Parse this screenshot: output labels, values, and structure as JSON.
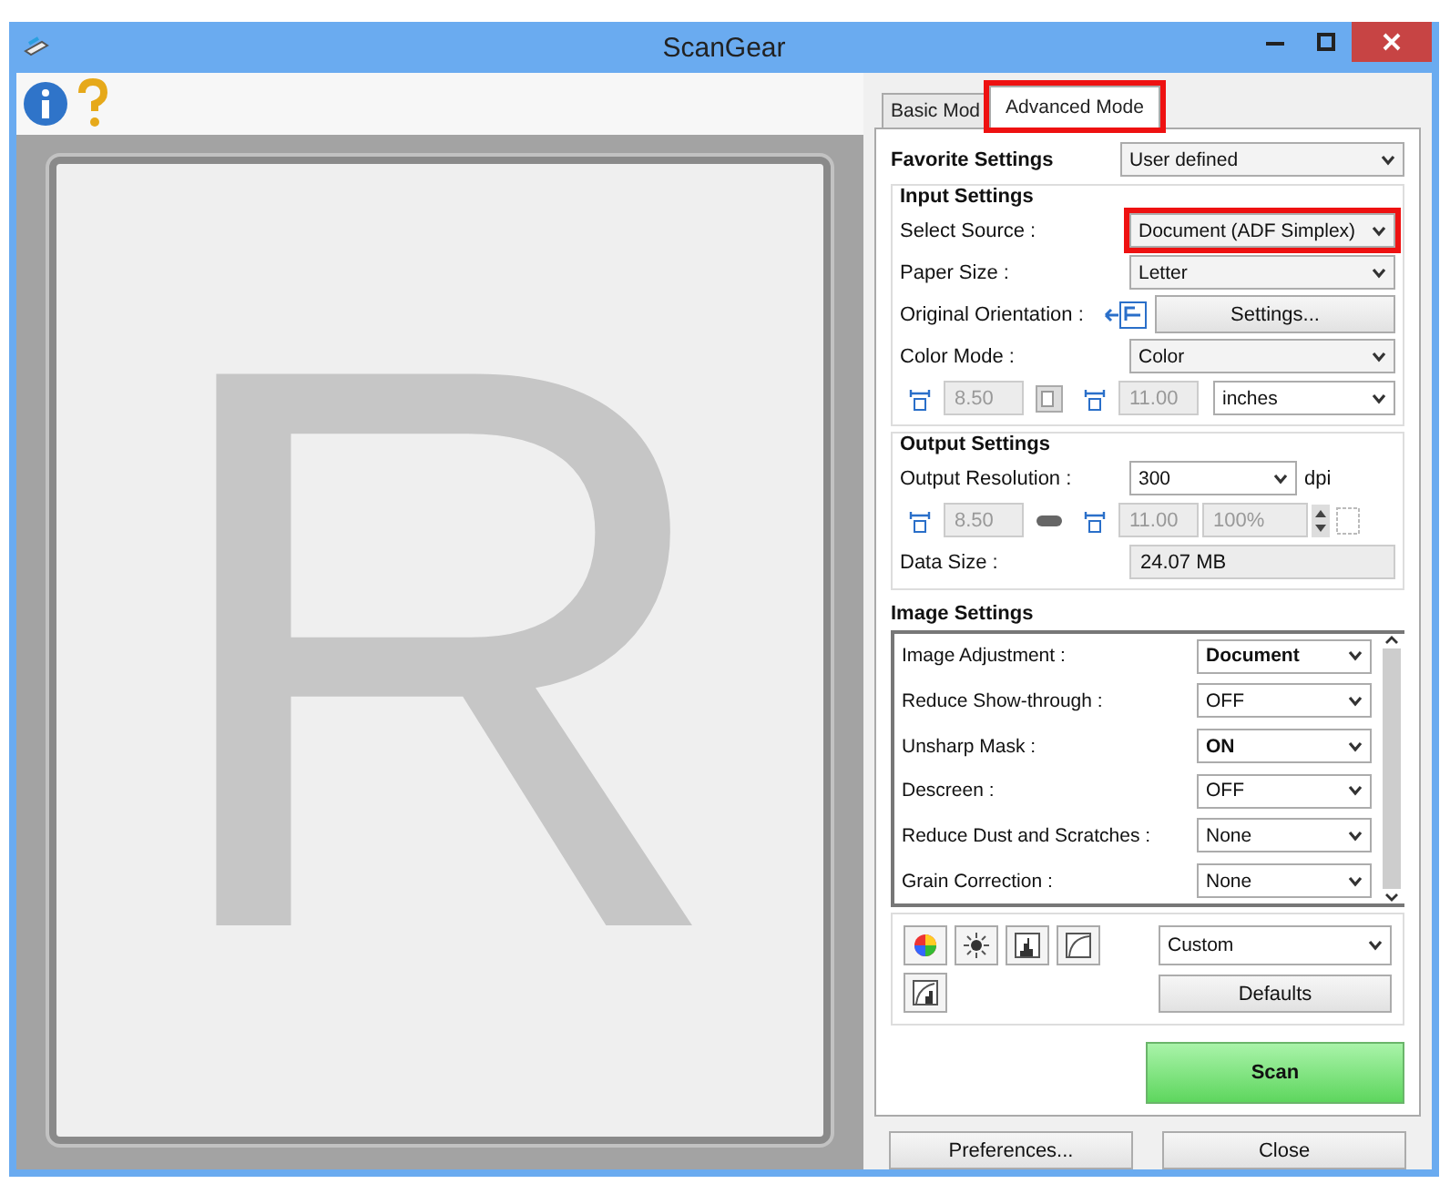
{
  "window": {
    "title": "ScanGear"
  },
  "preview": {
    "text": "R"
  },
  "tabs": [
    {
      "label": "Basic Mod",
      "selected": false,
      "highlighted": false
    },
    {
      "label": "Advanced Mode",
      "selected": true,
      "highlighted": true
    }
  ],
  "favorite": {
    "label": "Favorite Settings",
    "value": "User defined"
  },
  "input_settings": {
    "title": "Input Settings",
    "select_source": {
      "label": "Select Source :",
      "value": "Document (ADF Simplex)",
      "highlighted": true
    },
    "paper_size": {
      "label": "Paper Size :",
      "value": "Letter"
    },
    "orientation": {
      "label": "Original Orientation :",
      "button": "Settings..."
    },
    "color_mode": {
      "label": "Color Mode :",
      "value": "Color"
    },
    "width": {
      "value": "8.50",
      "disabled": true
    },
    "height": {
      "value": "11.00",
      "disabled": true
    },
    "unit": "inches"
  },
  "output_settings": {
    "title": "Output Settings",
    "resolution": {
      "label": "Output Resolution :",
      "value": "300",
      "unit": "dpi"
    },
    "width": {
      "value": "8.50",
      "disabled": true
    },
    "height": {
      "value": "11.00",
      "disabled": true
    },
    "scale": {
      "value": "100%",
      "disabled": true
    },
    "data_size": {
      "label": "Data Size :",
      "value": "24.07 MB"
    }
  },
  "image_settings": {
    "title": "Image Settings",
    "rows": [
      {
        "label": "Image Adjustment :",
        "value": "Document",
        "emphasized": true
      },
      {
        "label": "Reduce Show-through :",
        "value": "OFF",
        "emphasized": false
      },
      {
        "label": "Unsharp Mask :",
        "value": "ON",
        "emphasized": true
      },
      {
        "label": "Descreen :",
        "value": "OFF",
        "emphasized": false
      },
      {
        "label": "Reduce Dust and Scratches :",
        "value": "None",
        "emphasized": false
      },
      {
        "label": "Grain Correction :",
        "value": "None",
        "emphasized": false
      }
    ]
  },
  "presets": {
    "value": "Custom",
    "defaults": "Defaults"
  },
  "scan": "Scan",
  "buttons": [
    "Preferences...",
    "Close"
  ]
}
